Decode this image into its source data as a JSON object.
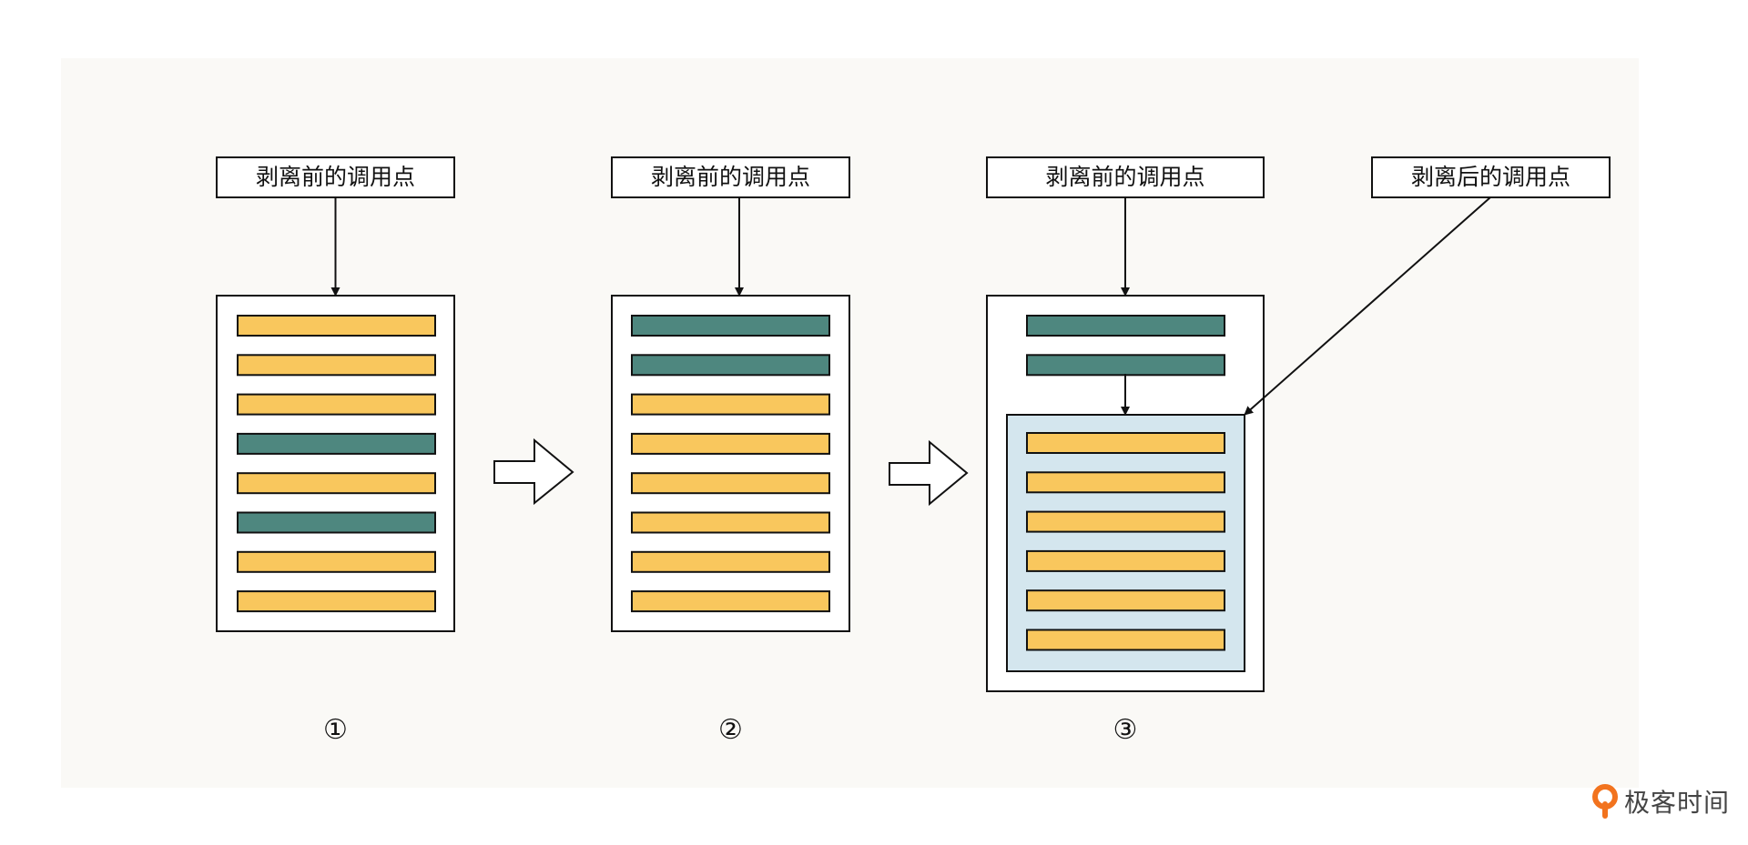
{
  "colors": {
    "background_panel": "#FAF9F6",
    "bar_yellow": "#F9C75D",
    "bar_teal": "#4E877F",
    "inner_box": "#D4E6EE",
    "stroke": "#111111",
    "logo_orange": "#F2731E"
  },
  "panels": [
    {
      "label": "剥离前的调用点",
      "number": "①",
      "bars": [
        "yellow",
        "yellow",
        "yellow",
        "teal",
        "yellow",
        "teal",
        "yellow",
        "yellow"
      ]
    },
    {
      "label": "剥离前的调用点",
      "number": "②",
      "bars": [
        "teal",
        "teal",
        "yellow",
        "yellow",
        "yellow",
        "yellow",
        "yellow",
        "yellow"
      ]
    },
    {
      "label": "剥离前的调用点",
      "number": "③",
      "bars_top": [
        "teal",
        "teal"
      ],
      "bars_inner": [
        "yellow",
        "yellow",
        "yellow",
        "yellow",
        "yellow",
        "yellow"
      ],
      "second_label": "剥离后的调用点"
    }
  ],
  "logo": {
    "icon": "geektime-logo-icon",
    "text": "极客时间"
  }
}
